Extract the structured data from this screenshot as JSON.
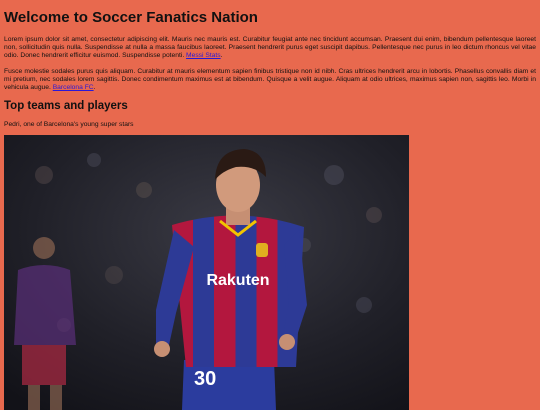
{
  "header": {
    "title": "Welcome to Soccer Fanatics Nation"
  },
  "intro": {
    "text": "Lorem ipsum dolor sit amet, consectetur adipiscing elit. Mauris nec mauris est. Curabitur feugiat ante nec tincidunt accumsan. Praesent dui enim, bibendum pellentesque laoreet non, sollicitudin quis nulla. Suspendisse at nulla a massa faucibus laoreet. Praesent hendrerit purus eget suscipit dapibus. Pellentesque nec purus in leo dictum rhoncus vel vitae odio. Donec hendrerit efficitur euismod. Suspendisse potenti. ",
    "link_label": "Messi Stats",
    "trailing": "."
  },
  "second": {
    "text": "Fusce molestie sodales purus quis aliquam. Curabitur at mauris elementum sapien finibus tristique non id nibh. Cras ultrices hendrerit arcu in lobortis. Phasellus convallis diam et mi pretium, nec sodales lorem sagittis. Donec condimentum maximus est at bibendum. Quisque a velit augue. Aliquam at odio ultrices, maximus sapien non, sagittis leo. Morbi in vehicula augue. ",
    "link_label": "Barcelona FC",
    "trailing": "."
  },
  "section": {
    "heading": "Top teams and players",
    "caption": "Pedri, one of Barcelona's young super stars"
  },
  "photo": {
    "sponsor": "Rakuten",
    "shirt_number": "30"
  },
  "colors": {
    "background": "#e8694e",
    "link": "#2a18d8"
  }
}
